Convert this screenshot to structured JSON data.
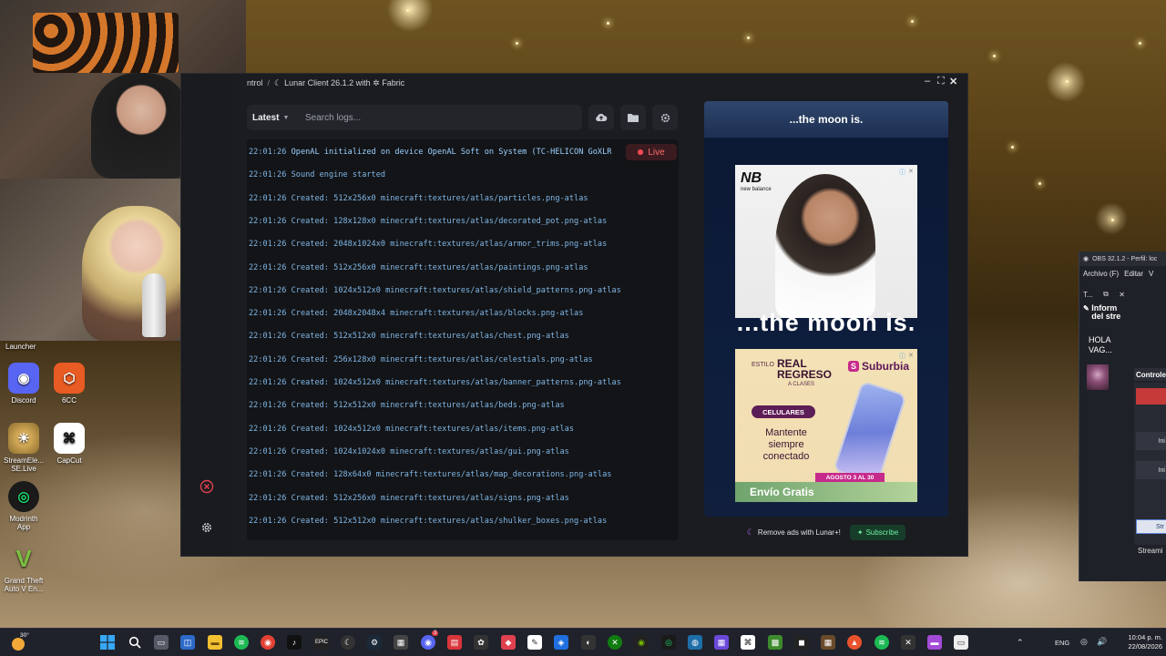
{
  "desktop": {
    "launcher_label": "Launcher",
    "icons": [
      {
        "label": "Discord",
        "glyph": "D",
        "color": "#5865f2"
      },
      {
        "label": "6CC",
        "glyph": "6",
        "color": "#e85b23"
      },
      {
        "label": "StreamEle...\nSE.Live",
        "glyph": "SE",
        "color": "#3b3b3b"
      },
      {
        "label": "CapCut",
        "glyph": "✂",
        "color": "#111111"
      },
      {
        "label": "Modrinth\nApp",
        "glyph": "◎",
        "color": "#1bd96a"
      },
      {
        "label": "Grand Theft\nAuto V En...",
        "glyph": "V",
        "color": "#2b3b22"
      }
    ]
  },
  "lunar": {
    "breadcrumb": {
      "parent": "ntrol",
      "separator": "/",
      "current": "Lunar Client 26.1.2 with ✲ Fabric"
    },
    "window_controls": {
      "minimize": "–",
      "maximize": "⛶",
      "close": "✕"
    },
    "version_select": "Latest",
    "search_placeholder": "Search logs...",
    "live_label": "Live",
    "logs": [
      {
        "ts": "22:01:26",
        "msg": "OpenAL initialized on device OpenAL Soft on System (TC-HELICON GoXLR"
      },
      {
        "ts": "22:01:26",
        "msg": "Sound engine started"
      },
      {
        "ts": "22:01:26",
        "msg": "Created: 512x256x0 minecraft:textures/atlas/particles.png-atlas"
      },
      {
        "ts": "22:01:26",
        "msg": "Created: 128x128x0 minecraft:textures/atlas/decorated_pot.png-atlas"
      },
      {
        "ts": "22:01:26",
        "msg": "Created: 2048x1024x0 minecraft:textures/atlas/armor_trims.png-atlas"
      },
      {
        "ts": "22:01:26",
        "msg": "Created: 512x256x0 minecraft:textures/atlas/paintings.png-atlas"
      },
      {
        "ts": "22:01:26",
        "msg": "Created: 1024x512x0 minecraft:textures/atlas/shield_patterns.png-atlas"
      },
      {
        "ts": "22:01:26",
        "msg": "Created: 2048x2048x4 minecraft:textures/atlas/blocks.png-atlas"
      },
      {
        "ts": "22:01:26",
        "msg": "Created: 512x512x0 minecraft:textures/atlas/chest.png-atlas"
      },
      {
        "ts": "22:01:26",
        "msg": "Created: 256x128x0 minecraft:textures/atlas/celestials.png-atlas"
      },
      {
        "ts": "22:01:26",
        "msg": "Created: 1024x512x0 minecraft:textures/atlas/banner_patterns.png-atlas"
      },
      {
        "ts": "22:01:26",
        "msg": "Created: 512x512x0 minecraft:textures/atlas/beds.png-atlas"
      },
      {
        "ts": "22:01:26",
        "msg": "Created: 1024x512x0 minecraft:textures/atlas/items.png-atlas"
      },
      {
        "ts": "22:01:26",
        "msg": "Created: 1024x1024x0 minecraft:textures/atlas/gui.png-atlas"
      },
      {
        "ts": "22:01:26",
        "msg": "Created: 128x64x0 minecraft:textures/atlas/map_decorations.png-atlas"
      },
      {
        "ts": "22:01:26",
        "msg": "Created: 512x256x0 minecraft:textures/atlas/signs.png-atlas"
      },
      {
        "ts": "22:01:26",
        "msg": "Created: 512x512x0 minecraft:textures/atlas/shulker_boxes.png-atlas"
      }
    ],
    "ad": {
      "header": "...the moon is.",
      "moon_big": "...the moon is.",
      "nb_logo": "NB",
      "nb_sub": "new balance",
      "second_estilo": "ESTILO",
      "second_real": "REAL\nREGRESO",
      "second_aclases": "A CLASES",
      "second_brand": "Suburbia",
      "second_celulares": "CELULARES",
      "second_mantente": "Mantente\nsiempre\nconectado",
      "second_fecha": "AGOSTO 3 AL 30",
      "second_envio": "Envío Gratis"
    },
    "remove_ads": "Remove ads with Lunar+!",
    "subscribe": "Subscribe"
  },
  "obs": {
    "title": "OBS 32.1.2 - Perfil: loc",
    "menu": [
      "Archivo (F)",
      "Editar",
      "V"
    ],
    "dock_label": "T...",
    "info_title": "Inform\ndel stre",
    "hola": "HOLA\nVAG...",
    "controls_label": "Controle",
    "items": [
      "Ini",
      "Ini"
    ],
    "strm": "Str",
    "stream_label": "Streami"
  },
  "taskbar": {
    "temp": "30°",
    "lang": "ENG",
    "time": "10:04 p. m.",
    "date": "22/08/2026",
    "notification_badge": "3"
  }
}
